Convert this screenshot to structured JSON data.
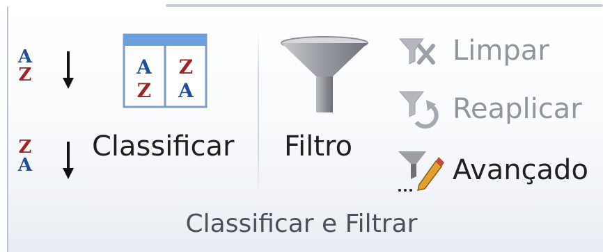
{
  "group": {
    "title": "Classificar e Filtrar"
  },
  "sort": {
    "az_letters": [
      "A",
      "Z"
    ],
    "za_letters": [
      "Z",
      "A"
    ],
    "classificar": {
      "label": "Classificar",
      "grid_letters": [
        "A",
        "Z",
        "Z",
        "A"
      ]
    }
  },
  "filter": {
    "filtro_label": "Filtro",
    "limpar_label": "Limpar",
    "reaplicar_label": "Reaplicar",
    "avancado_label": "Avançado"
  },
  "colors": {
    "letter_blue": "#1f4e9c",
    "letter_red": "#a02222",
    "disabled_text": "#8f959c"
  }
}
